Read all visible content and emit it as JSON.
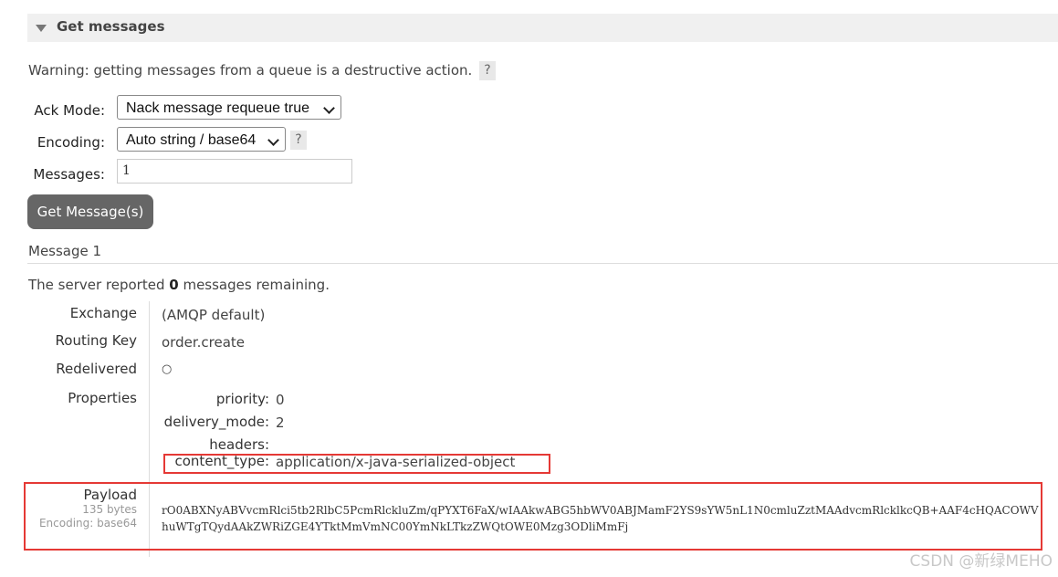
{
  "section": {
    "title": "Get messages"
  },
  "warning": {
    "text": "Warning: getting messages from a queue is a destructive action.",
    "help": "?"
  },
  "form": {
    "ack_mode_label": "Ack Mode:",
    "ack_mode_value": "Nack message requeue true",
    "encoding_label": "Encoding:",
    "encoding_value": "Auto string / base64",
    "encoding_help": "?",
    "messages_label": "Messages:",
    "messages_value": "1",
    "get_button": "Get Message(s)"
  },
  "message": {
    "title": "Message 1",
    "remaining_prefix": "The server reported ",
    "remaining_count": "0",
    "remaining_suffix": " messages remaining.",
    "exchange_label": "Exchange",
    "exchange_value": "(AMQP default)",
    "routing_key_label": "Routing Key",
    "routing_key_value": "order.create",
    "redelivered_label": "Redelivered",
    "redelivered_value": "○",
    "properties_label": "Properties",
    "properties": {
      "priority_label": "priority:",
      "priority_value": "0",
      "delivery_mode_label": "delivery_mode:",
      "delivery_mode_value": "2",
      "headers_label": "headers:",
      "content_type_label": "content_type:",
      "content_type_value": "application/x-java-serialized-object"
    },
    "payload_label": "Payload",
    "payload_bytes": "135 bytes",
    "payload_encoding": "Encoding: base64",
    "payload_line1": "rO0ABXNyABVvcmRlci5tb2RlbC5PcmRlckluZm/qPYXT6FaX/wIAAkwABG5hbWV0ABJMamF2YS9sYW5nL1N0cmluZztMAAdvcmRlcklkcQB+AAF4cHQACOWV",
    "payload_line2": "huWTgTQydAAkZWRiZGE4YTktMmVmNC00YmNkLTkzZWQtOWE0Mzg3ODliMmFj"
  },
  "watermark": "CSDN @新绿MEHO"
}
